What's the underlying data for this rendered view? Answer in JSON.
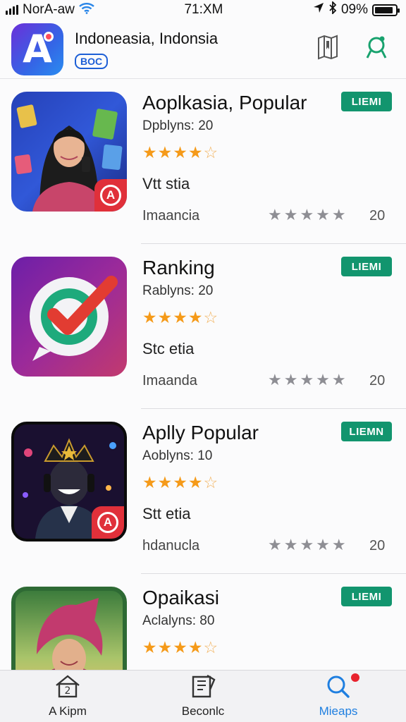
{
  "status_bar": {
    "carrier": "NorA‑aw",
    "time": "71:XM",
    "battery_label": "09%",
    "battery_level": 0.9,
    "icons": [
      "signal-icon",
      "wifi-icon",
      "location-icon",
      "bluetooth-icon",
      "battery-icon"
    ]
  },
  "header": {
    "title": "Indoneasia, Indonsia",
    "badge": "BOC",
    "logo_letter": "A",
    "tools": [
      "bookmark-icon",
      "location-pin-icon"
    ]
  },
  "apps": [
    {
      "name": "Aoplkasia, Popular",
      "downloads": "Dpblyns: 20",
      "rating": 4,
      "rating_max": 5,
      "status": "Vtt stia",
      "category": "Imaancia",
      "review_count": "20",
      "button": "LIEMI",
      "has_corner_badge": true
    },
    {
      "name": "Ranking",
      "downloads": "Rablyns: 20",
      "rating": 4,
      "rating_max": 5,
      "status": "Stc etia",
      "category": "Imaanda",
      "review_count": "20",
      "button": "LIEMI",
      "has_corner_badge": false
    },
    {
      "name": "Aplly Popular",
      "downloads": "Aoblyns: 10",
      "rating": 4,
      "rating_max": 5,
      "status": "Stt etia",
      "category": "hdanucla",
      "review_count": "20",
      "button": "LIEMN",
      "has_corner_badge": true
    },
    {
      "name": "Opaikasi",
      "downloads": "Aclalyns: 80",
      "rating": 4,
      "rating_max": 5,
      "status": "",
      "category": "",
      "review_count": "",
      "button": "LIEMI",
      "has_corner_badge": false
    }
  ],
  "corner_badge_letter": "A",
  "tabbar": {
    "tabs": [
      {
        "label": "A Kipm",
        "icon": "home-icon",
        "active": false
      },
      {
        "label": "Beconlc",
        "icon": "bookmark-list-icon",
        "active": false
      },
      {
        "label": "Mieaps",
        "icon": "search-icon",
        "active": true
      }
    ]
  },
  "colors": {
    "accent_green": "#12956e",
    "star_orange": "#f59a19",
    "tab_active_blue": "#1f7fe0",
    "logo_gradient_start": "#6b2fd9",
    "logo_gradient_end": "#2a8cf0"
  }
}
